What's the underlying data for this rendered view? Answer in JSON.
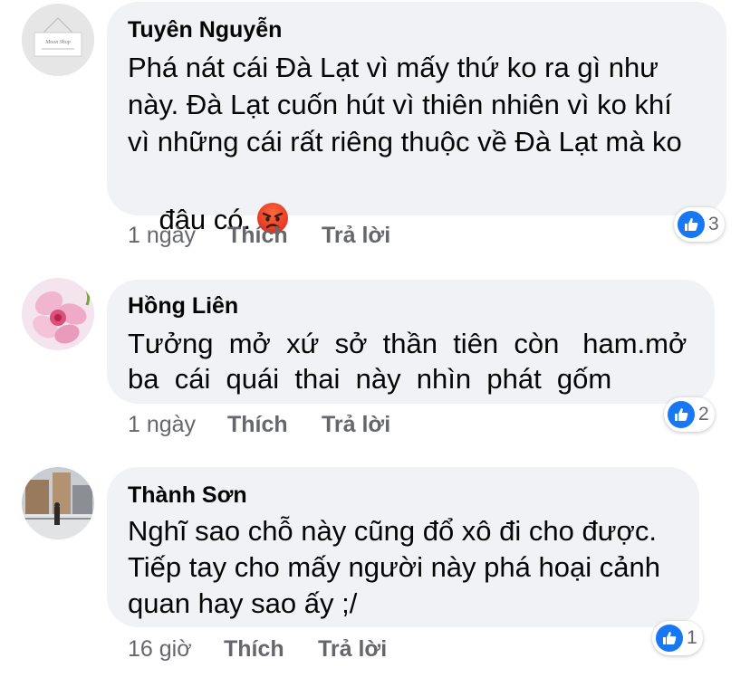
{
  "comments": [
    {
      "author": "Tuyên Nguyễn",
      "lines": [
        "Phá nát cái Đà Lạt vì mấy thứ ko ra gì như",
        "này. Đà Lạt cuốn hút vì thiên nhiên vì ko khí",
        "vì những cái rất riêng thuộc về Đà Lạt mà ko",
        "đâu có."
      ],
      "emoji": "angry-face-icon",
      "time": "1 ngày",
      "like_label": "Thích",
      "reply_label": "Trả lời",
      "reaction_count": "3",
      "avatar_text": "Moon Shop"
    },
    {
      "author": "Hồng Liên",
      "lines": [
        "Tưởng  mở  xứ  sở  thần  tiên  còn   ham.mở",
        "ba  cái  quái  thai  này  nhìn  phát  gốm"
      ],
      "time": "1 ngày",
      "like_label": "Thích",
      "reply_label": "Trả lời",
      "reaction_count": "2"
    },
    {
      "author": "Thành Sơn",
      "lines": [
        "Nghĩ sao chỗ này cũng đổ xô đi cho được.",
        "Tiếp tay cho mấy người này phá hoại cảnh",
        "quan hay sao ấy ;/"
      ],
      "time": "16 giờ",
      "like_label": "Thích",
      "reply_label": "Trả lời",
      "reaction_count": "1"
    }
  ],
  "colors": {
    "bubble": "#f0f2f5",
    "meta": "#65676b",
    "like_blue": "#1877f2"
  }
}
